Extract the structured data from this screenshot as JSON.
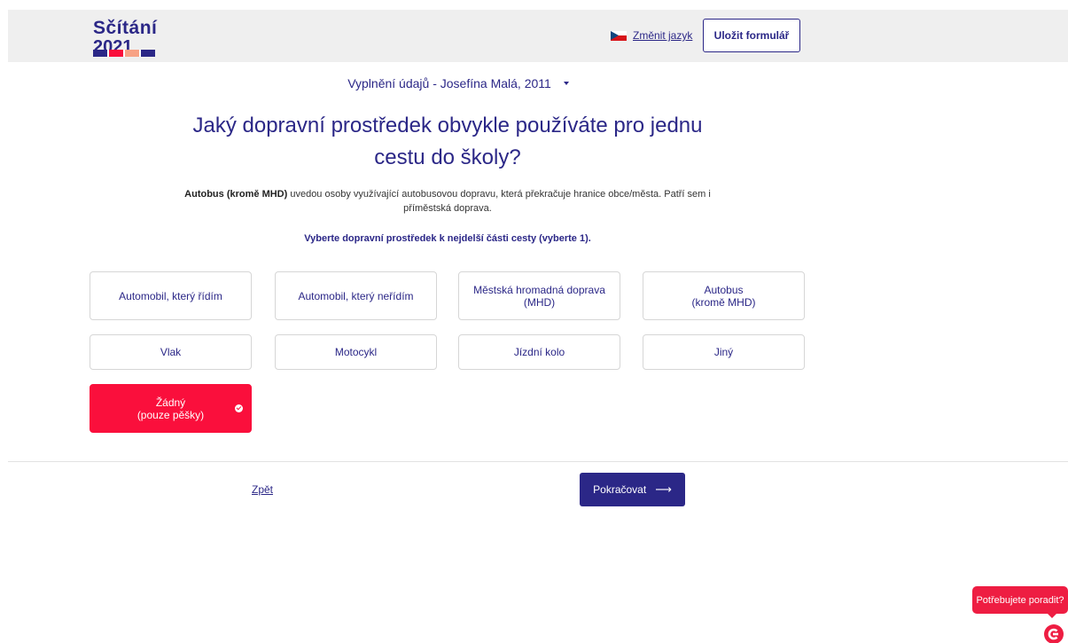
{
  "header": {
    "logo_text": "Sčítání",
    "logo_year": "2021",
    "change_language_label": "Změnit jazyk",
    "save_form_label": "Uložit formulář",
    "colors": {
      "brand_blue": "#2b2787",
      "brand_red": "#fa0f3c",
      "brand_peach": "#f7a285",
      "header_bg": "#efefef"
    }
  },
  "person_selector": {
    "label": "Vyplnění údajů - Josefína Malá, 2011"
  },
  "question": {
    "title": "Jaký dopravní prostředek obvykle používáte pro jednu cestu do školy?"
  },
  "note": {
    "bold": "Autobus (kromě MHD)",
    "text": " uvedou osoby využívající autobusovou dopravu, která překračuje hranice obce/města. Patří sem i příměstská doprava."
  },
  "instruction": "Vyberte dopravní prostředek k nejdelší části cesty (vyberte 1).",
  "options": [
    {
      "label": "Automobil, který řídím"
    },
    {
      "label": "Automobil, který neřídím"
    },
    {
      "line1": "Městská hromadná doprava",
      "line2": "(MHD)"
    },
    {
      "line1": "Autobus",
      "line2": "(kromě MHD)"
    },
    {
      "label": "Vlak"
    },
    {
      "label": "Motocykl"
    },
    {
      "label": "Jízdní kolo"
    },
    {
      "label": "Jiný"
    },
    {
      "line1": "Žádný",
      "line2": "(pouze pěšky)",
      "selected": true
    }
  ],
  "navigation": {
    "back_label": "Zpět",
    "continue_label": "Pokračovat",
    "continue_arrow": "⟶"
  },
  "help": {
    "label": "Potřebujete poradit?"
  }
}
